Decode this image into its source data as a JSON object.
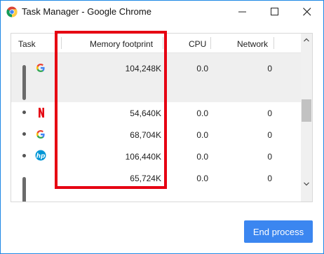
{
  "window": {
    "title": "Task Manager - Google Chrome",
    "border_color": "#1e88e5"
  },
  "table": {
    "columns": [
      "Task",
      "Memory footprint",
      "CPU",
      "Network"
    ],
    "rows": [
      {
        "icon": "google-g-icon",
        "memory": "104,248K",
        "cpu": "0.0",
        "network": "0",
        "selected": true
      },
      {
        "icon": "netflix-icon",
        "memory": "54,640K",
        "cpu": "0.0",
        "network": "0"
      },
      {
        "icon": "google-g-icon",
        "memory": "68,704K",
        "cpu": "0.0",
        "network": "0"
      },
      {
        "icon": "hp-icon",
        "memory": "106,440K",
        "cpu": "0.0",
        "network": "0"
      },
      {
        "icon": "",
        "memory": "65,724K",
        "cpu": "0.0",
        "network": "0"
      }
    ]
  },
  "annotation": {
    "color": "#e60012"
  },
  "actions": {
    "end_process": "End process",
    "accent": "#3b86f0"
  }
}
